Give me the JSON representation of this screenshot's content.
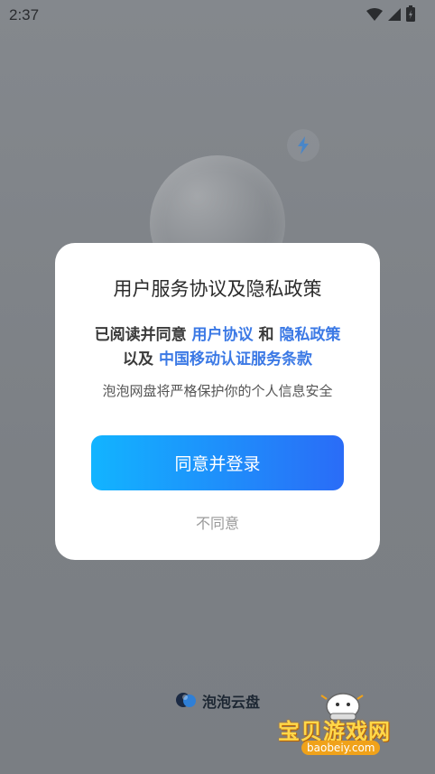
{
  "status_bar": {
    "time": "2:37"
  },
  "dialog": {
    "title": "用户服务协议及隐私政策",
    "line1_prefix": "已阅读并同意 ",
    "link_user_agreement": "用户协议",
    "line1_and": " 和 ",
    "link_privacy_policy": "隐私政策",
    "line2_prefix": "以及 ",
    "link_cmcc_terms": "中国移动认证服务条款",
    "note": "泡泡网盘将严格保护你的个人信息安全",
    "agree_label": "同意并登录",
    "decline_label": "不同意"
  },
  "brand": {
    "name": "泡泡云盘"
  },
  "watermark": {
    "text": "宝贝游戏网",
    "url": "baobeiy.com"
  },
  "colors": {
    "accent_start": "#12b4ff",
    "accent_end": "#2a6cf7",
    "link": "#3b79e5"
  },
  "icons": [
    "wifi-icon",
    "signal-icon",
    "battery-charging-icon",
    "lightning-icon",
    "brand-logo-icon"
  ]
}
